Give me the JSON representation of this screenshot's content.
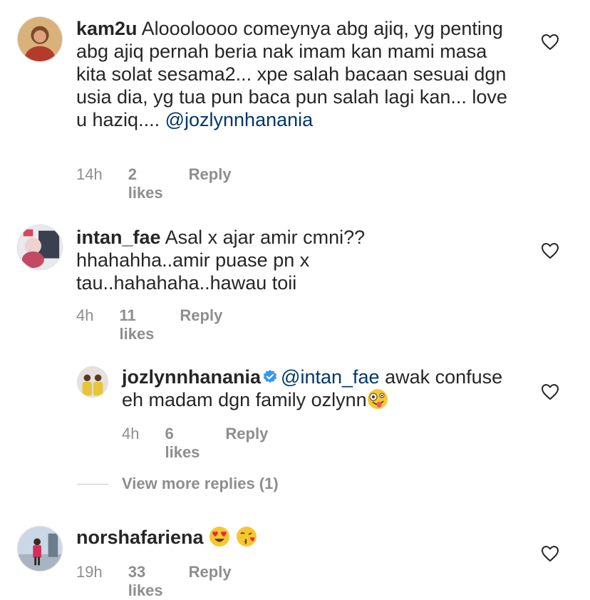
{
  "comments": [
    {
      "username": "kam2u",
      "text": "Aloooloooo comeynya abg ajiq, yg penting abg ajiq pernah beria nak imam kan mami masa kita solat sesama2... xpe salah bacaan sesuai dgn usia dia, yg tua pun baca pun salah lagi kan... love u haziq....",
      "mention": "@jozlynnhanania",
      "time": "14h",
      "likes": "2 likes",
      "reply": "Reply"
    },
    {
      "username": "intan_fae",
      "text": "Asal x ajar amir cmni?? hhahahha..amir puase pn x tau..hahahaha..hawau toii",
      "time": "4h",
      "likes": "11 likes",
      "reply": "Reply"
    },
    {
      "username": "jozlynnhanania",
      "mention": "@intan_fae",
      "text": "awak confuse eh madam dgn family ozlynn",
      "time": "4h",
      "likes": "6 likes",
      "reply": "Reply"
    },
    {
      "username": "norshafariena",
      "time": "19h",
      "likes": "33 likes",
      "reply": "Reply"
    }
  ],
  "view_more": "View more replies (1)",
  "icons": {
    "like": "heart-outline-icon",
    "verified": "verified-badge-icon",
    "emoji_crazy": "zany-face-emoji",
    "emoji_heart_eyes": "heart-eyes-emoji",
    "emoji_kiss": "kissing-face-emoji"
  },
  "colors": {
    "mention": "#00376b",
    "verified": "#3897f0",
    "meta": "#8e8e8e"
  }
}
